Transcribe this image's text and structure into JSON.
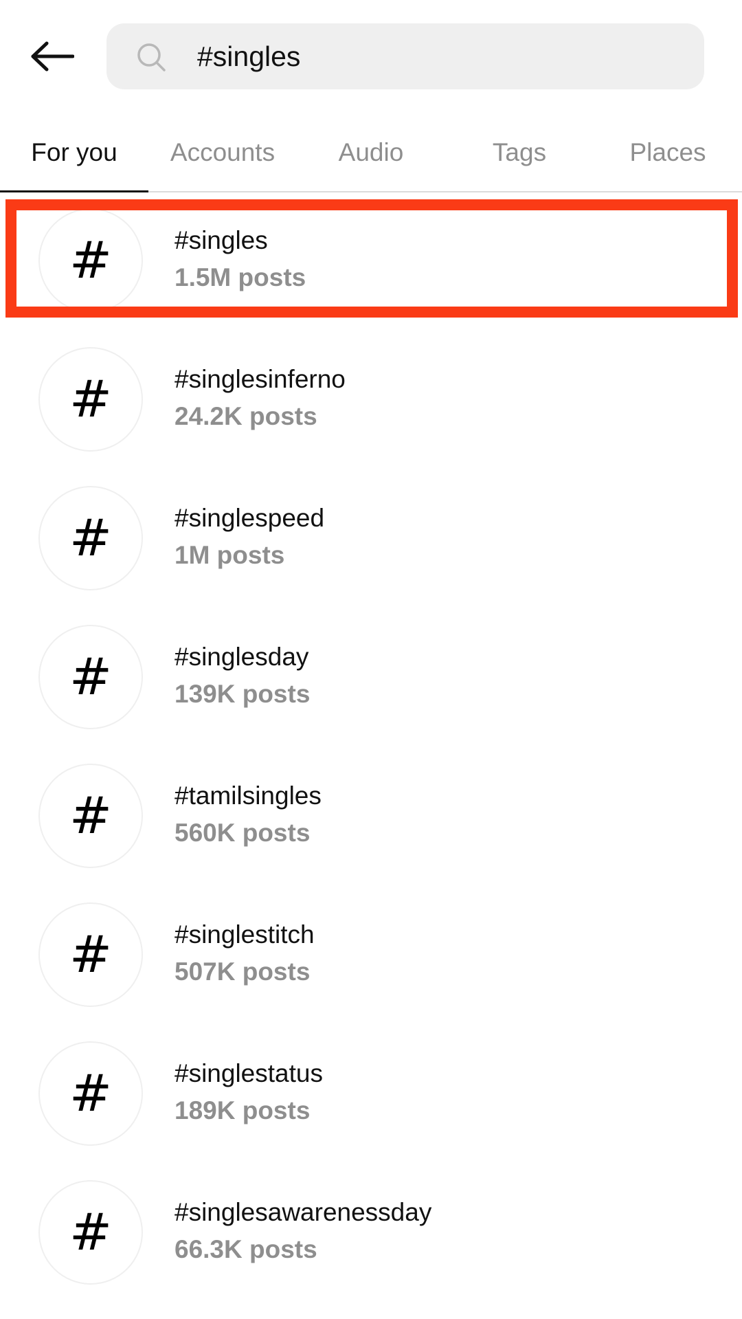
{
  "header": {
    "back_icon": "arrow-left-icon",
    "search_icon": "search-icon",
    "search_value": "#singles"
  },
  "tabs": [
    {
      "label": "For you",
      "active": true
    },
    {
      "label": "Accounts",
      "active": false
    },
    {
      "label": "Audio",
      "active": false
    },
    {
      "label": "Tags",
      "active": false
    },
    {
      "label": "Places",
      "active": false
    }
  ],
  "results": [
    {
      "icon": "#",
      "name": "#singles",
      "count": "1.5M posts"
    },
    {
      "icon": "#",
      "name": "#singlesinferno",
      "count": "24.2K posts"
    },
    {
      "icon": "#",
      "name": "#singlespeed",
      "count": "1M posts"
    },
    {
      "icon": "#",
      "name": "#singlesday",
      "count": "139K posts"
    },
    {
      "icon": "#",
      "name": "#tamilsingles",
      "count": "560K posts"
    },
    {
      "icon": "#",
      "name": "#singlestitch",
      "count": "507K posts"
    },
    {
      "icon": "#",
      "name": "#singlestatus",
      "count": "189K posts"
    },
    {
      "icon": "#",
      "name": "#singlesawarenessday",
      "count": "66.3K posts"
    }
  ],
  "colors": {
    "highlight": "#fa3b16",
    "secondary_text": "#8e8e8e",
    "search_bg": "#efefef"
  }
}
